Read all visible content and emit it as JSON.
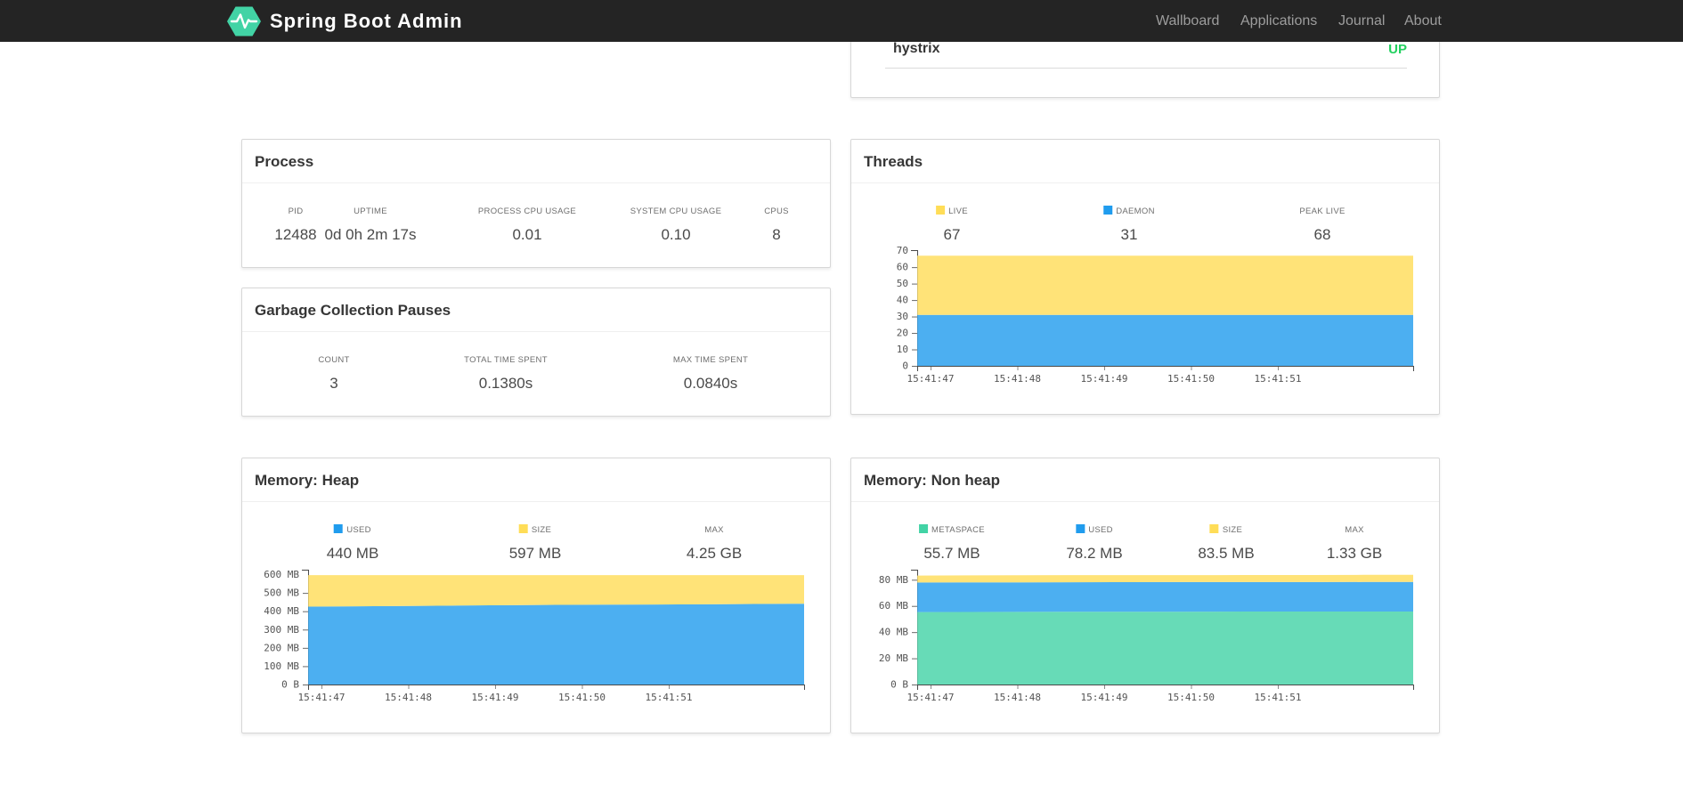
{
  "navbar": {
    "brand": "Spring Boot Admin",
    "items": [
      {
        "label": "Wallboard"
      },
      {
        "label": "Applications"
      },
      {
        "label": "Journal"
      },
      {
        "label": "About"
      }
    ]
  },
  "application": {
    "name": "hystrix",
    "status": "UP",
    "status_color": "#23d160"
  },
  "theme": {
    "navbar_bg": "#242424",
    "brand_green": "#42d3a5",
    "yellow": "#ffdd57",
    "blue": "#209cee",
    "green": "#42d3a5",
    "yellow_area": "#ffe378",
    "blue_area": "#4caff1",
    "green_area": "#67dbb7",
    "status_up": "#23d160",
    "axis": "#4a4a4a"
  },
  "cards": {
    "process": {
      "title": "Process",
      "metrics": [
        {
          "label": "PID",
          "value": "12488"
        },
        {
          "label": "UPTIME",
          "value": "0d 0h 2m 17s"
        },
        {
          "label": "PROCESS CPU USAGE",
          "value": "0.01"
        },
        {
          "label": "SYSTEM CPU USAGE",
          "value": "0.10"
        },
        {
          "label": "CPUS",
          "value": "8"
        }
      ]
    },
    "gc": {
      "title": "Garbage Collection Pauses",
      "metrics": [
        {
          "label": "COUNT",
          "value": "3"
        },
        {
          "label": "TOTAL TIME SPENT",
          "value": "0.1380s"
        },
        {
          "label": "MAX TIME SPENT",
          "value": "0.0840s"
        }
      ]
    },
    "threads": {
      "title": "Threads",
      "metrics": [
        {
          "label": "LIVE",
          "value": "67",
          "swatch": "yellow"
        },
        {
          "label": "DAEMON",
          "value": "31",
          "swatch": "blue"
        },
        {
          "label": "PEAK LIVE",
          "value": "68"
        }
      ]
    },
    "heap": {
      "title": "Memory: Heap",
      "metrics": [
        {
          "label": "USED",
          "value": "440 MB",
          "swatch": "blue"
        },
        {
          "label": "SIZE",
          "value": "597 MB",
          "swatch": "yellow"
        },
        {
          "label": "MAX",
          "value": "4.25 GB"
        }
      ]
    },
    "nonheap": {
      "title": "Memory: Non heap",
      "metrics": [
        {
          "label": "METASPACE",
          "value": "55.7 MB",
          "swatch": "green"
        },
        {
          "label": "USED",
          "value": "78.2 MB",
          "swatch": "blue"
        },
        {
          "label": "SIZE",
          "value": "83.5 MB",
          "swatch": "yellow"
        },
        {
          "label": "MAX",
          "value": "1.33 GB"
        }
      ]
    }
  },
  "chart_data": [
    {
      "id": "threads",
      "type": "area",
      "stacked": true,
      "title": "Threads",
      "x_tick_labels": [
        "15:41:47",
        "15:41:48",
        "15:41:49",
        "15:41:50",
        "15:41:51"
      ],
      "ylim": [
        0,
        70.35
      ],
      "yticks": {
        "values": [
          0,
          10,
          20,
          30,
          40,
          50,
          60,
          70
        ],
        "labels": [
          "0",
          "10",
          "20",
          "30",
          "40",
          "50",
          "60",
          "70"
        ]
      },
      "legend_position": "top",
      "grid": false,
      "series": [
        {
          "name": "DAEMON",
          "color_key": "blue",
          "values": [
            31,
            31,
            31,
            31,
            31,
            31,
            31,
            31,
            31,
            31,
            31
          ]
        },
        {
          "name": "LIVE",
          "color_key": "yellow",
          "values": [
            67,
            67,
            67,
            67,
            67,
            67,
            67,
            67,
            67,
            67,
            67
          ]
        }
      ]
    },
    {
      "id": "heap",
      "type": "area",
      "stacked": true,
      "title": "Memory: Heap",
      "x_tick_labels": [
        "15:41:47",
        "15:41:48",
        "15:41:49",
        "15:41:50",
        "15:41:51"
      ],
      "ylim": [
        0,
        626.85
      ],
      "yticks": {
        "values": [
          0,
          100,
          200,
          300,
          400,
          500,
          600
        ],
        "labels": [
          "0 B",
          "100 MB",
          "200 MB",
          "300 MB",
          "400 MB",
          "500 MB",
          "600 MB"
        ]
      },
      "legend_position": "top",
      "grid": false,
      "series": [
        {
          "name": "USED",
          "color_key": "blue",
          "values": [
            425,
            427,
            429,
            431,
            433,
            435,
            436,
            437,
            438,
            440,
            441
          ]
        },
        {
          "name": "SIZE",
          "color_key": "yellow",
          "values": [
            597,
            597,
            597,
            597,
            597,
            597,
            597,
            597,
            597,
            597,
            597
          ]
        }
      ]
    },
    {
      "id": "nonheap",
      "type": "area",
      "stacked": true,
      "title": "Memory: Non heap",
      "x_tick_labels": [
        "15:41:47",
        "15:41:48",
        "15:41:49",
        "15:41:50",
        "15:41:51"
      ],
      "ylim": [
        0,
        87.675
      ],
      "yticks": {
        "values": [
          0,
          20,
          40,
          60,
          80
        ],
        "labels": [
          "0 B",
          "20 MB",
          "40 MB",
          "60 MB",
          "80 MB"
        ]
      },
      "legend_position": "top",
      "grid": false,
      "series": [
        {
          "name": "METASPACE",
          "color_key": "green",
          "values": [
            55.3,
            55.4,
            55.45,
            55.5,
            55.55,
            55.6,
            55.65,
            55.7,
            55.7,
            55.7,
            55.7
          ]
        },
        {
          "name": "USED",
          "color_key": "blue",
          "values": [
            77.9,
            78.0,
            78.05,
            78.1,
            78.15,
            78.2,
            78.2,
            78.25,
            78.2,
            78.3,
            78.3
          ]
        },
        {
          "name": "SIZE",
          "color_key": "yellow",
          "values": [
            83.2,
            83.3,
            83.4,
            83.5,
            83.5,
            83.5,
            83.55,
            83.6,
            83.6,
            83.7,
            83.7
          ]
        }
      ]
    }
  ]
}
